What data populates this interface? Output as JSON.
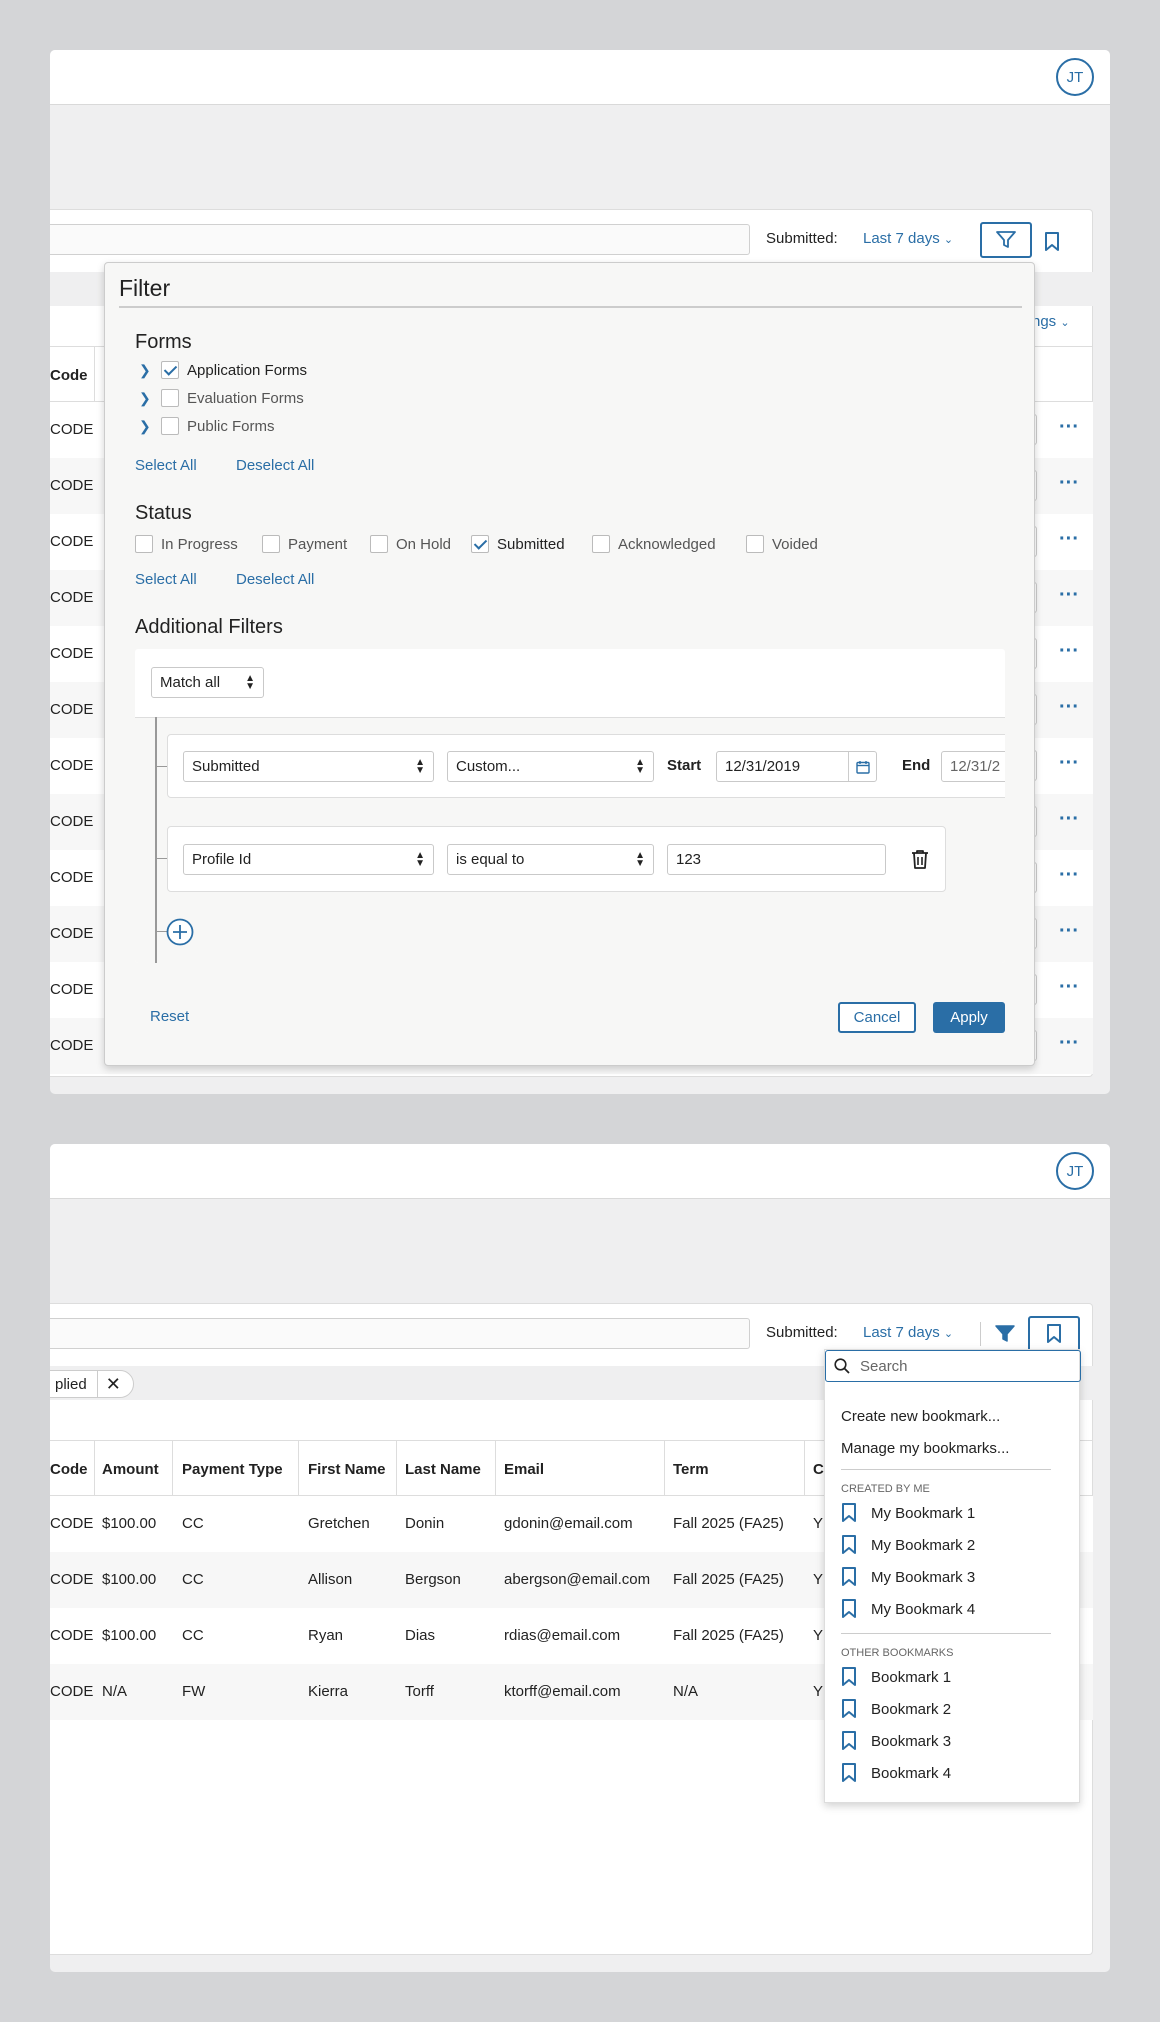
{
  "top": {
    "avatar": "JT",
    "submitted_label": "Submitted:",
    "date_range": "Last 7 days",
    "settings_partial": "ngs",
    "code_header": "Code",
    "code_value": "CODE"
  },
  "filter": {
    "title": "Filter",
    "forms_heading": "Forms",
    "forms": [
      {
        "label": "Application Forms",
        "checked": true
      },
      {
        "label": "Evaluation Forms",
        "checked": false
      },
      {
        "label": "Public Forms",
        "checked": false
      }
    ],
    "select_all": "Select All",
    "deselect_all": "Deselect All",
    "status_heading": "Status",
    "statuses": [
      {
        "label": "In Progress",
        "checked": false
      },
      {
        "label": "Payment",
        "checked": false
      },
      {
        "label": "On Hold",
        "checked": false
      },
      {
        "label": "Submitted",
        "checked": true
      },
      {
        "label": "Acknowledged",
        "checked": false
      },
      {
        "label": "Voided",
        "checked": false
      }
    ],
    "additional_heading": "Additional Filters",
    "match": "Match all",
    "rule1": {
      "field": "Submitted",
      "operator": "Custom...",
      "start_label": "Start",
      "start": "12/31/2019",
      "end_label": "End",
      "end": "12/31/2"
    },
    "rule2": {
      "field": "Profile Id",
      "operator": "is equal to",
      "value": "123"
    },
    "reset": "Reset",
    "cancel": "Cancel",
    "apply": "Apply"
  },
  "bottom": {
    "avatar": "JT",
    "submitted_label": "Submitted:",
    "date_range": "Last 7 days",
    "applied_chip": "plied",
    "table": {
      "headers": [
        "Code",
        "Amount",
        "Payment Type",
        "First Name",
        "Last Name",
        "Email",
        "Term",
        "C"
      ],
      "rows": [
        [
          "CODE",
          "$100.00",
          "CC",
          "Gretchen",
          "Donin",
          "gdonin@email.com",
          "Fall 2025 (FA25)",
          "Y"
        ],
        [
          "CODE",
          "$100.00",
          "CC",
          "Allison",
          "Bergson",
          "abergson@email.com",
          "Fall 2025 (FA25)",
          "Y"
        ],
        [
          "CODE",
          "$100.00",
          "CC",
          "Ryan",
          "Dias",
          "rdias@email.com",
          "Fall 2025 (FA25)",
          "Y"
        ],
        [
          "CODE",
          "N/A",
          "FW",
          "Kierra",
          "Torff",
          "ktorff@email.com",
          "N/A",
          "Y"
        ]
      ]
    },
    "bookmarks": {
      "search_placeholder": "Search",
      "create": "Create new bookmark...",
      "manage": "Manage my bookmarks...",
      "created_by_me_heading": "CREATED BY ME",
      "mine": [
        "My Bookmark 1",
        "My Bookmark 2",
        "My Bookmark 3",
        "My Bookmark 4"
      ],
      "other_heading": "OTHER BOOKMARKS",
      "others": [
        "Bookmark 1",
        "Bookmark 2",
        "Bookmark 3",
        "Bookmark 4"
      ]
    }
  },
  "colors": {
    "accent": "#2a6ea6",
    "background": "#d4d5d7"
  }
}
